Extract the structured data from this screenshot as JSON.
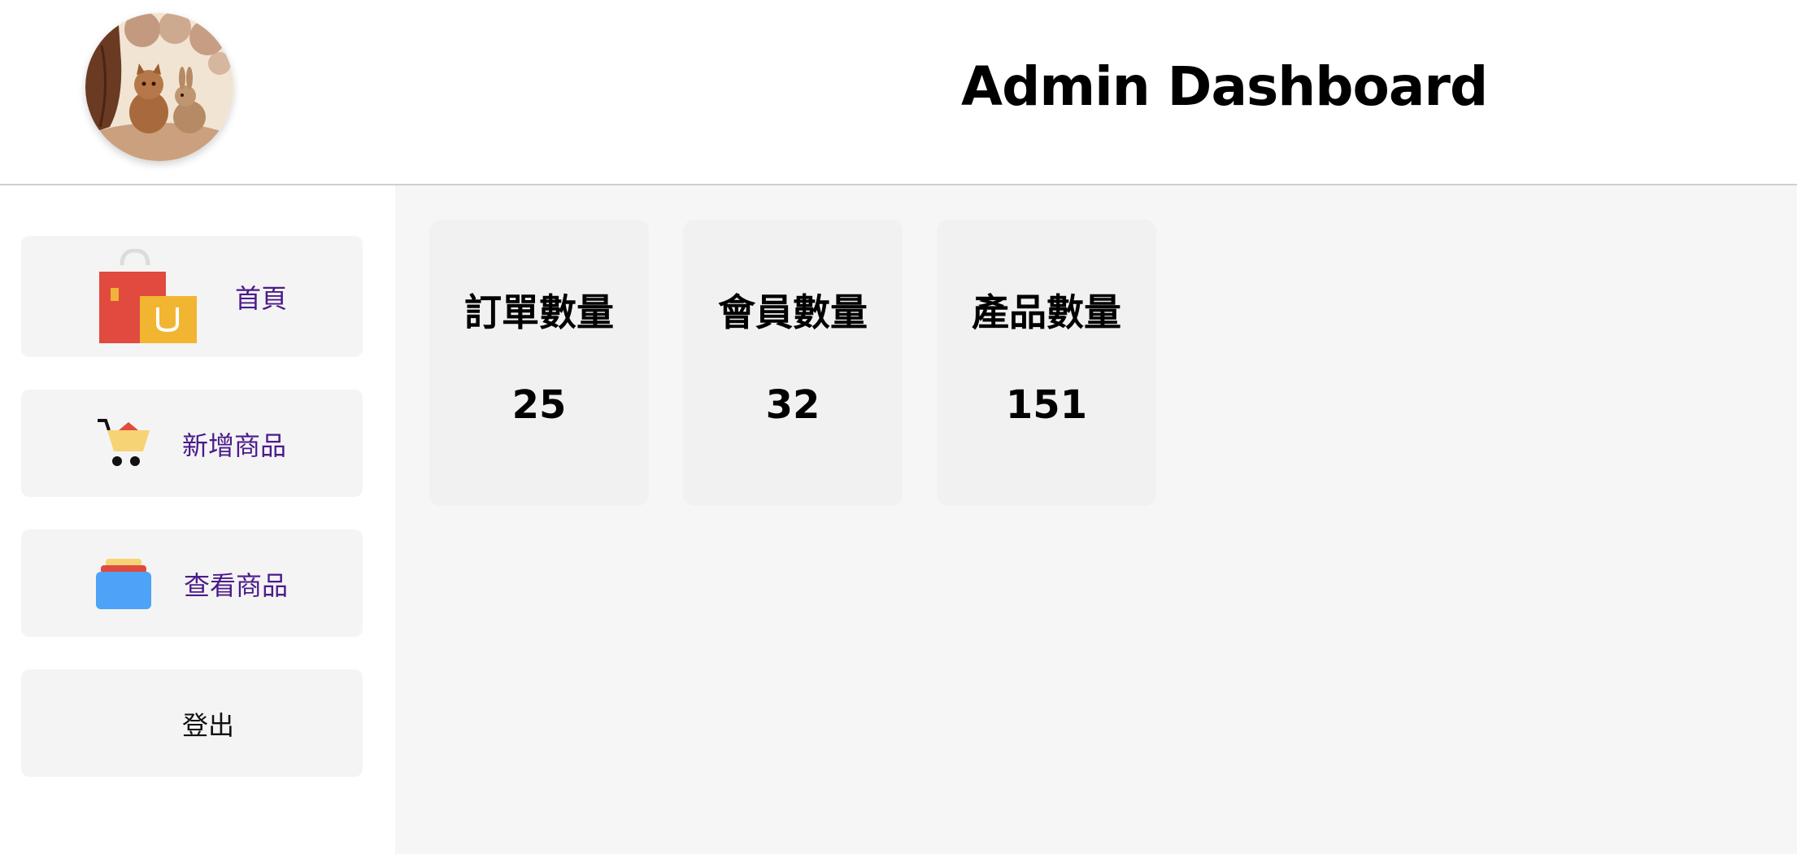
{
  "header": {
    "title": "Admin Dashboard",
    "logo_icon": "cat-and-rabbit-logo"
  },
  "sidebar": {
    "items": [
      {
        "label": "首頁",
        "icon": "shopping-bags-icon"
      },
      {
        "label": "新增商品",
        "icon": "shopping-cart-icon"
      },
      {
        "label": "查看商品",
        "icon": "product-stack-icon"
      },
      {
        "label": "登出",
        "icon": ""
      }
    ]
  },
  "stats": [
    {
      "label": "訂單數量",
      "value": "25"
    },
    {
      "label": "會員數量",
      "value": "32"
    },
    {
      "label": "產品數量",
      "value": "151"
    }
  ],
  "colors": {
    "nav_text": "#4b1a8a",
    "card_bg": "#f1f1f1",
    "main_bg": "#f6f6f6"
  }
}
